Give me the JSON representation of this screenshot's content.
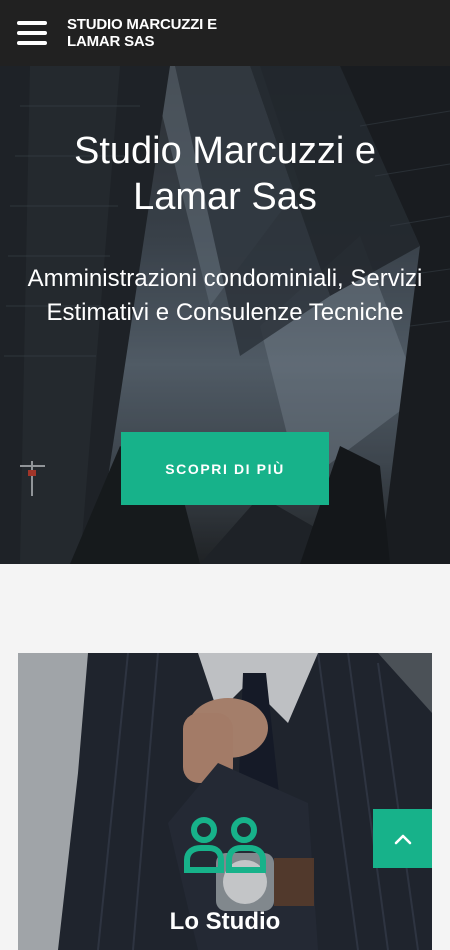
{
  "navbar": {
    "menu_icon": "hamburger-icon",
    "brand": "STUDIO MARCUZZI E LAMAR SAS"
  },
  "hero": {
    "title": "Studio Marcuzzi e Lamar Sas",
    "subtitle": "Amministrazioni condominiali, Servizi Estimativi e Consulenze Tecniche",
    "button_label": "SCOPRI DI PIÙ"
  },
  "card": {
    "icon": "users-icon",
    "title": "Lo Studio"
  },
  "scroll_top": {
    "icon": "chevron-up-icon"
  },
  "colors": {
    "navbar_bg": "#212121",
    "accent": "#17b28a",
    "page_bg": "#f4f4f4",
    "text_light": "#ffffff"
  }
}
